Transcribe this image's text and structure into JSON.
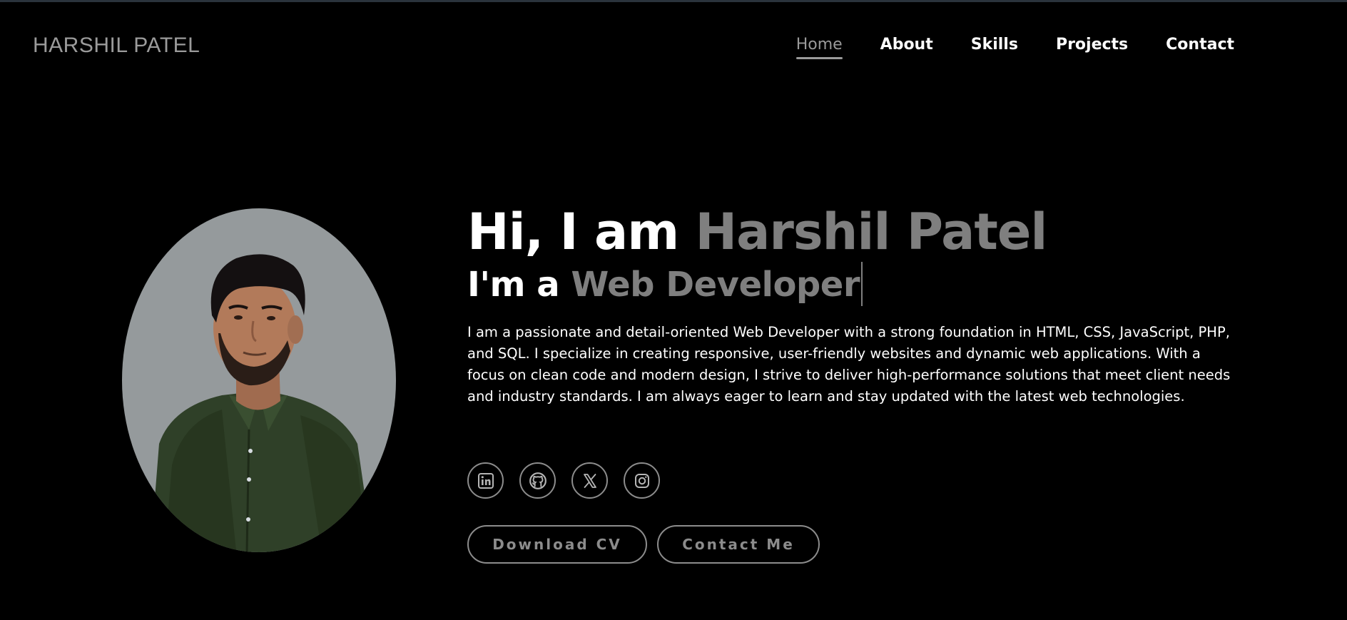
{
  "header": {
    "logo": "HARSHIL PATEL",
    "nav": [
      {
        "label": "Home",
        "active": true
      },
      {
        "label": "About",
        "active": false
      },
      {
        "label": "Skills",
        "active": false
      },
      {
        "label": "Projects",
        "active": false
      },
      {
        "label": "Contact",
        "active": false
      }
    ]
  },
  "hero": {
    "greeting": "Hi, I am ",
    "name": "Harshil Patel",
    "role_prefix": "I'm a ",
    "role": "Web Developer",
    "description": "I am a passionate and detail-oriented Web Developer with a strong foundation in HTML, CSS, JavaScript, PHP, and SQL. I specialize in creating responsive, user-friendly websites and dynamic web applications. With a focus on clean code and modern design, I strive to deliver high-performance solutions that meet client needs and industry standards. I am always eager to learn and stay updated with the latest web technologies."
  },
  "socials": [
    {
      "icon": "linkedin-icon"
    },
    {
      "icon": "github-icon"
    },
    {
      "icon": "x-icon"
    },
    {
      "icon": "instagram-icon"
    }
  ],
  "buttons": {
    "download_cv": "Download CV",
    "contact_me": "Contact Me"
  },
  "colors": {
    "background": "#000000",
    "accent_gray": "#7f7f7f",
    "portrait_bg": "#959a9c"
  }
}
